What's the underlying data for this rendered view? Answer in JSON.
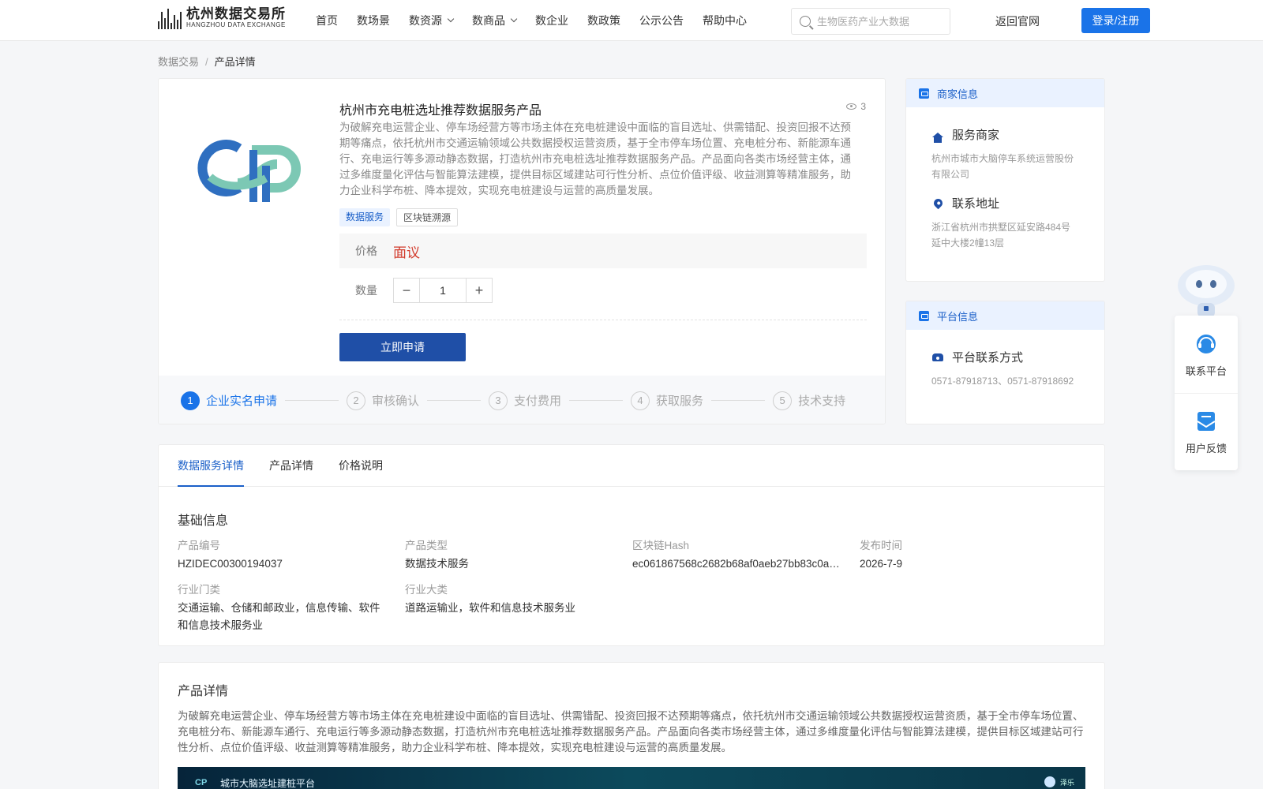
{
  "header": {
    "logo_cn": "杭州数据交易所",
    "logo_en": "HANGZHOU DATA EXCHANGE",
    "nav": [
      {
        "label": "首页"
      },
      {
        "label": "数场景"
      },
      {
        "label": "数资源"
      },
      {
        "label": "数商品"
      },
      {
        "label": "数企业"
      },
      {
        "label": "数政策"
      },
      {
        "label": "公示公告"
      },
      {
        "label": "帮助中心"
      }
    ],
    "search_placeholder": "生物医药产业大数据",
    "back_label": "返回官网",
    "login_label": "登录/注册"
  },
  "breadcrumb": {
    "root": "数据交易",
    "separator": "/",
    "current": "产品详情"
  },
  "product": {
    "title": "杭州市充电桩选址推荐数据服务产品",
    "views": "3",
    "description": "为破解充电运营企业、停车场经营方等市场主体在充电桩建设中面临的盲目选址、供需错配、投资回报不达预期等痛点，依托杭州市交通运输领域公共数据授权运营资质，基于全市停车场位置、充电桩分布、新能源车通行、充电运行等多源动静态数据，打造杭州市充电桩选址推荐数据服务产品。产品面向各类市场经营主体，通过多维度量化评估与智能算法建模，提供目标区域建站可行性分析、点位价值评级、收益测算等精准服务，助力企业科学布桩、降本提效，实现充电桩建设与运营的高质量发展。",
    "tags": [
      "数据服务",
      "区块链溯源"
    ],
    "price_label": "价格",
    "price_value": "面议",
    "qty_label": "数量",
    "qty_value": "1",
    "qty_minus": "−",
    "qty_plus": "+",
    "apply_label": "立即申请",
    "steps": [
      {
        "num": "1",
        "label": "企业实名申请"
      },
      {
        "num": "2",
        "label": "审核确认"
      },
      {
        "num": "3",
        "label": "支付费用"
      },
      {
        "num": "4",
        "label": "获取服务"
      },
      {
        "num": "5",
        "label": "技术支持"
      }
    ]
  },
  "merchant": {
    "head": "商家信息",
    "service_title": "服务商家",
    "service_value": "杭州市城市大脑停车系统运营股份有限公司",
    "address_title": "联系地址",
    "address_value": "浙江省杭州市拱墅区延安路484号延中大楼2幢13层"
  },
  "platform": {
    "head": "平台信息",
    "contact_title": "平台联系方式",
    "contact_value": "0571-87918713、0571-87918692"
  },
  "float": {
    "contact_label": "联系平台",
    "feedback_label": "用户反馈"
  },
  "tabs": [
    {
      "label": "数据服务详情"
    },
    {
      "label": "产品详情"
    },
    {
      "label": "价格说明"
    }
  ],
  "basic": {
    "title": "基础信息",
    "fields": [
      {
        "key": "产品编号",
        "value": "HZIDEC00300194037"
      },
      {
        "key": "产品类型",
        "value": "数据技术服务"
      },
      {
        "key": "区块链Hash",
        "value": "ec061867568c2682b68af0aeb27bb83c0a…"
      },
      {
        "key": "发布时间",
        "value": "2026-7-9"
      },
      {
        "key": "行业门类",
        "value": "交通运输、仓储和邮政业，信息传输、软件和信息技术服务业"
      },
      {
        "key": "行业大类",
        "value": "道路运输业，软件和信息技术服务业"
      }
    ]
  },
  "detail": {
    "title": "产品详情",
    "text": "为破解充电运营企业、停车场经营方等市场主体在充电桩建设中面临的盲目选址、供需错配、投资回报不达预期等痛点，依托杭州市交通运输领域公共数据授权运营资质，基于全市停车场位置、充电桩分布、新能源车通行、充电运行等多源动静态数据，打造杭州市充电桩选址推荐数据服务产品。产品面向各类市场经营主体，通过多维度量化评估与智能算法建模，提供目标区域建站可行性分析、点位价值评级、收益测算等精准服务，助力企业科学布桩、降本提效，实现充电桩建设与运营的高质量发展。",
    "banner_logo": "CP",
    "banner_title": "城市大脑选址建桩平台",
    "banner_user": "泽乐"
  },
  "colors": {
    "primary": "#1a73e8",
    "brand_dark": "#1f4fa7",
    "price": "#d23a2b"
  }
}
